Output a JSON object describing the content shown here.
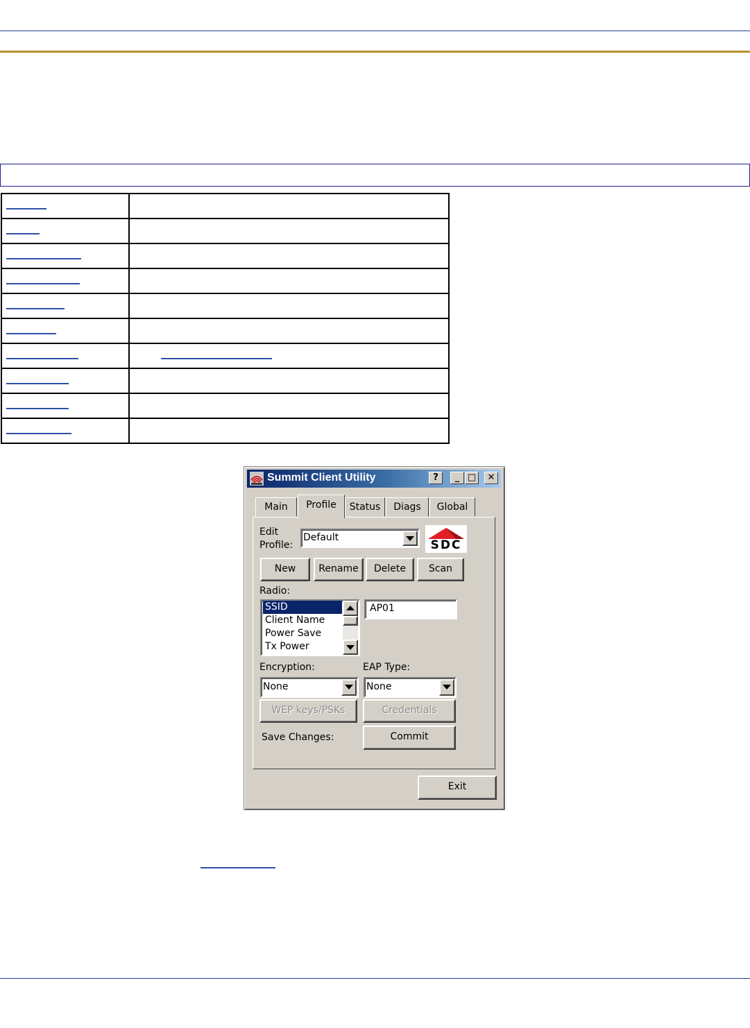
{
  "window": {
    "title": "Summit Client Utility",
    "help_button": "?",
    "minimize_button": "_",
    "maximize_button": "□",
    "close_button": "✕"
  },
  "tabs": [
    {
      "label": "Main"
    },
    {
      "label": "Profile",
      "active": true
    },
    {
      "label": "Status"
    },
    {
      "label": "Diags"
    },
    {
      "label": "Global"
    }
  ],
  "profile": {
    "edit_profile_label_1": "Edit",
    "edit_profile_label_2": "Profile:",
    "edit_profile_value": "Default",
    "logo_text": "SDC",
    "buttons": {
      "new": "New",
      "rename": "Rename",
      "delete": "Delete",
      "scan": "Scan"
    },
    "radio_label": "Radio:",
    "radio_items": [
      "SSID",
      "Client Name",
      "Power Save",
      "Tx Power"
    ],
    "radio_selected": "SSID",
    "value_field": "AP01",
    "encryption_label": "Encryption:",
    "encryption_value": "None",
    "eap_type_label": "EAP Type:",
    "eap_type_value": "None",
    "wep_button": "WEP keys/PSKs",
    "credentials_button": "Credentials",
    "save_changes_label": "Save Changes:",
    "commit_button": "Commit"
  },
  "exit_button": "Exit",
  "colors": {
    "title_gradient_start": "#0a246a",
    "title_gradient_end": "#a6caf0",
    "window_face": "#d4d0c8",
    "selection": "#0a246a",
    "logo_red": "#e01f26",
    "rule_gold": "#b8902a",
    "link_blue": "#2c4fa8"
  }
}
